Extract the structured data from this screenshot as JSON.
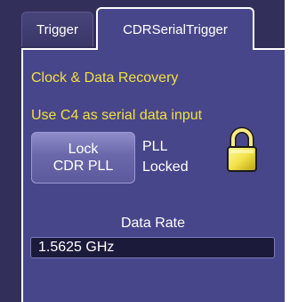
{
  "tabs": [
    {
      "label": "Trigger",
      "active": false
    },
    {
      "label": "CDRSerialTrigger",
      "active": true
    }
  ],
  "section_title": "Clock & Data Recovery",
  "serial_input_text": "Use C4 as serial data input",
  "lock_button": {
    "line1": "Lock",
    "line2": "CDR PLL"
  },
  "pll_status": {
    "line1": "PLL",
    "line2": "Locked"
  },
  "status_icon": "padlock-icon",
  "data_rate": {
    "label": "Data Rate",
    "value": "1.5625 GHz"
  },
  "colors": {
    "panel": "#48468a",
    "background": "#32305a",
    "highlight_text": "#f0e040",
    "field_bg": "#1c1a3a"
  }
}
